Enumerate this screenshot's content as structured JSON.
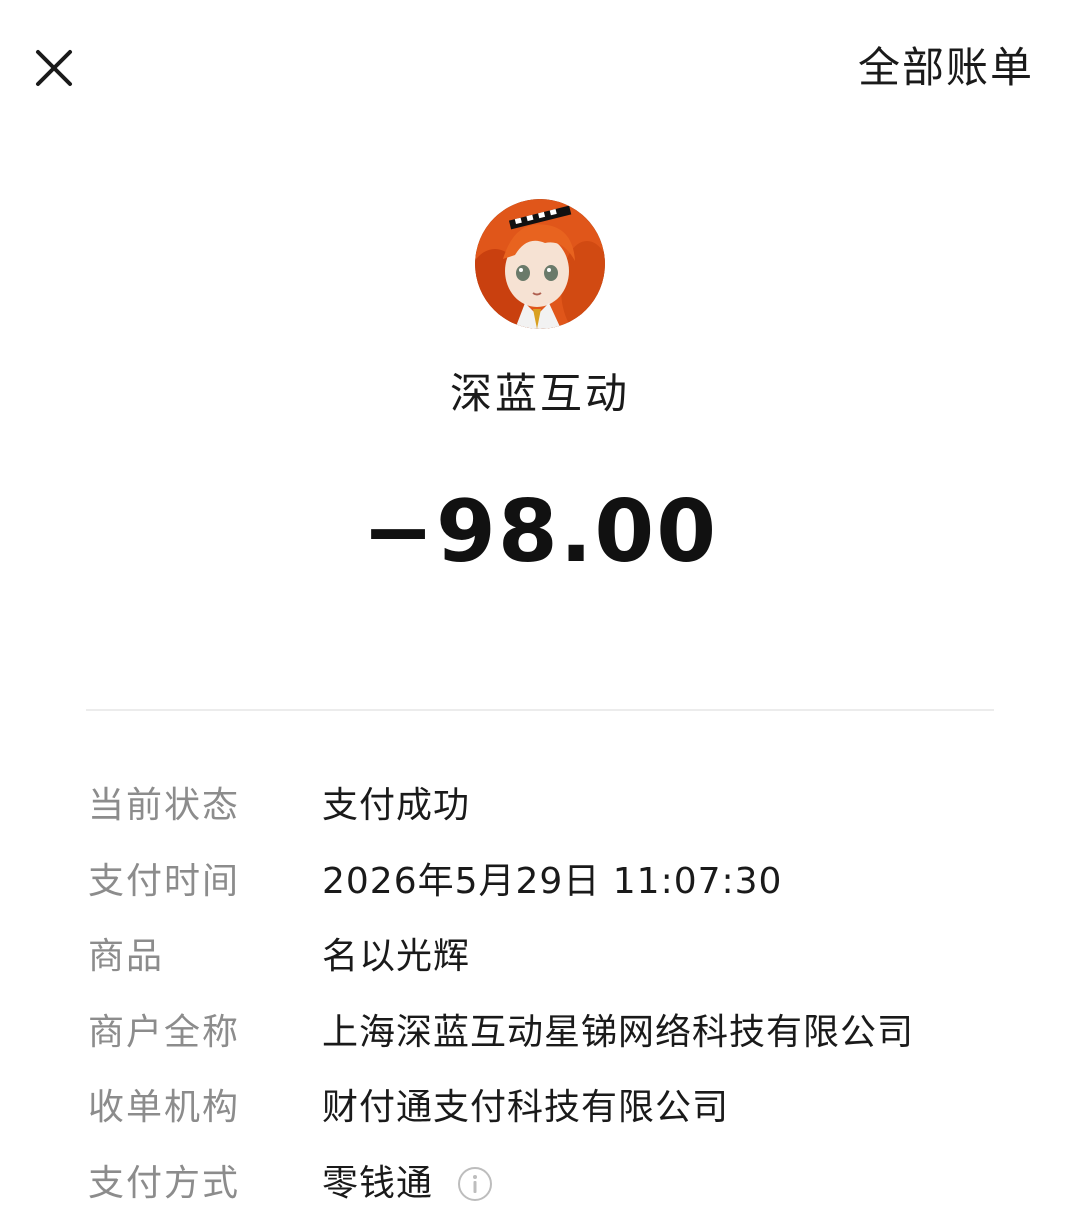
{
  "header": {
    "close_icon": "close-icon",
    "all_bills_label": "全部账单"
  },
  "merchant": {
    "avatar_icon": "merchant-avatar",
    "name": "深蓝互动",
    "amount": "−98.00"
  },
  "details": [
    {
      "label": "当前状态",
      "value": "支付成功"
    },
    {
      "label": "支付时间",
      "value": "2026年5月29日 11:07:30"
    },
    {
      "label": "商品",
      "value": "名以光辉"
    },
    {
      "label": "商户全称",
      "value": "上海深蓝互动星锑网络科技有限公司"
    },
    {
      "label": "收单机构",
      "value": "财付通支付科技有限公司"
    },
    {
      "label": "支付方式",
      "value": "零钱通",
      "icon": "info-icon"
    }
  ],
  "colors": {
    "text_primary": "#1a1a1a",
    "text_secondary": "#8c8c8c",
    "divider": "#ececec",
    "avatar_hair": "#e0561a"
  }
}
